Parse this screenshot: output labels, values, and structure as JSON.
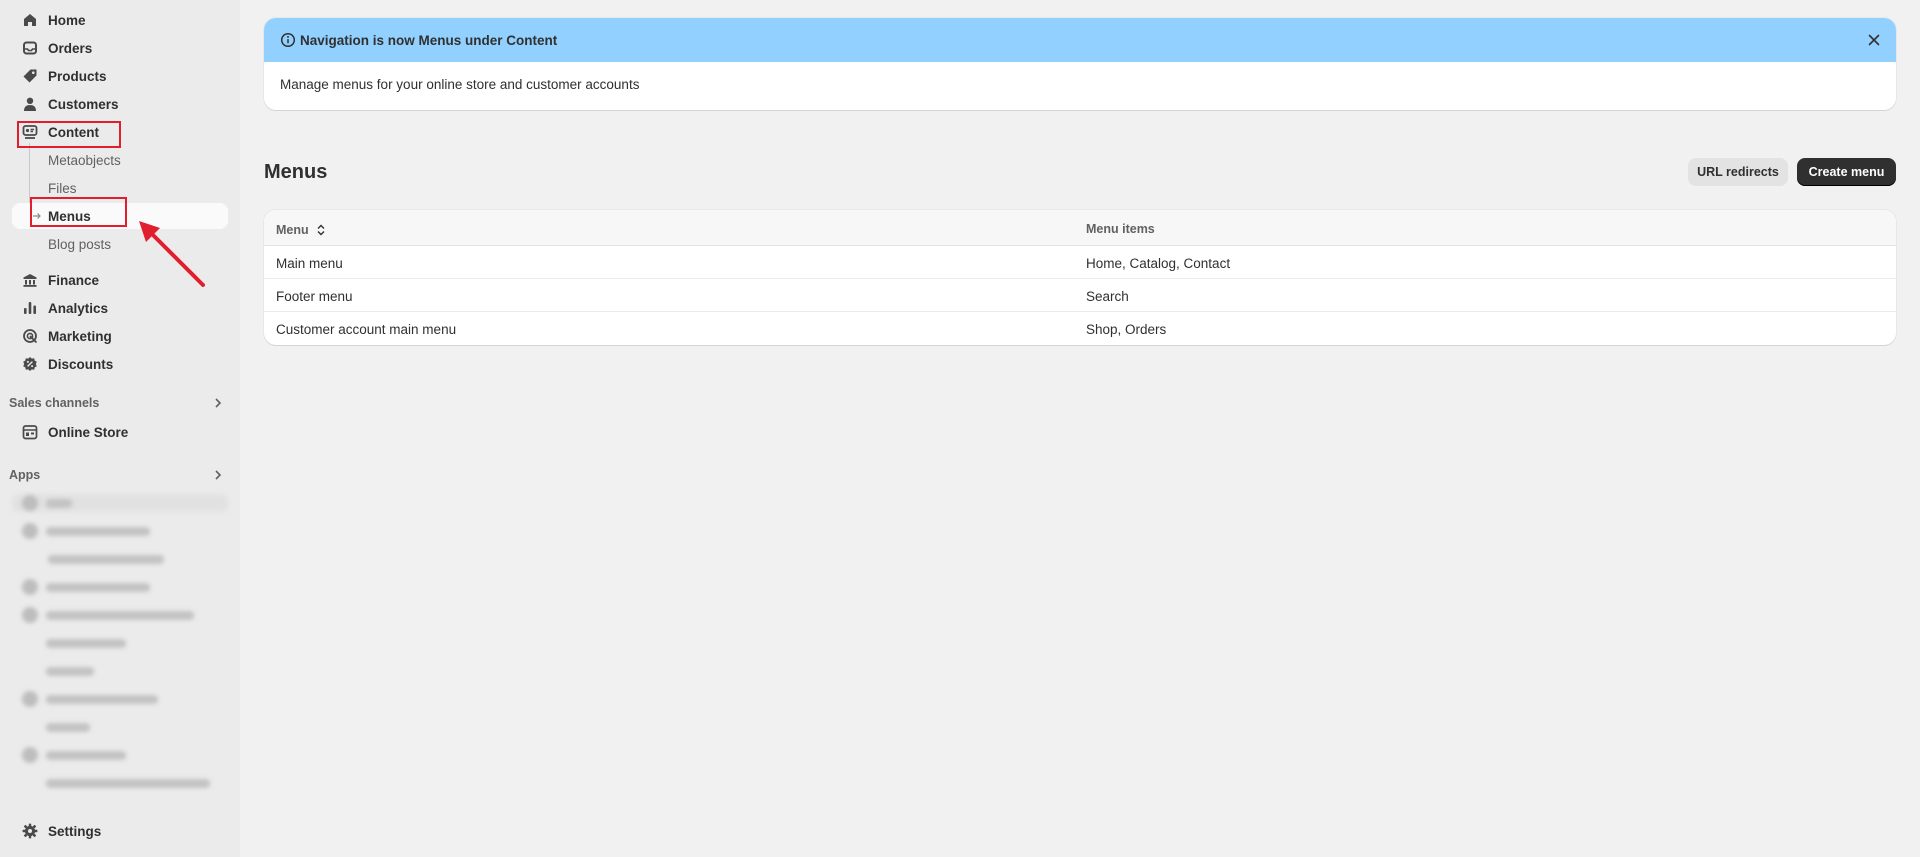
{
  "sidebar": {
    "items": [
      {
        "label": "Home",
        "icon": "home-icon"
      },
      {
        "label": "Orders",
        "icon": "inbox-icon"
      },
      {
        "label": "Products",
        "icon": "tag-icon"
      },
      {
        "label": "Customers",
        "icon": "person-icon"
      },
      {
        "label": "Content",
        "icon": "content-icon"
      },
      {
        "label": "Metaobjects"
      },
      {
        "label": "Files"
      },
      {
        "label": "Menus"
      },
      {
        "label": "Blog posts"
      },
      {
        "label": "Finance",
        "icon": "bank-icon"
      },
      {
        "label": "Analytics",
        "icon": "bar-chart-icon"
      },
      {
        "label": "Marketing",
        "icon": "target-icon"
      },
      {
        "label": "Discounts",
        "icon": "discount-icon"
      }
    ],
    "sales_channels": {
      "heading": "Sales channels",
      "items": [
        {
          "label": "Online Store",
          "icon": "store-icon"
        }
      ]
    },
    "apps": {
      "heading": "Apps"
    },
    "settings": {
      "label": "Settings",
      "icon": "gear-icon"
    }
  },
  "banner": {
    "title": "Navigation is now Menus under Content",
    "body": "Manage menus for your online store and customer accounts"
  },
  "page": {
    "title": "Menus",
    "secondary_action": "URL redirects",
    "primary_action": "Create menu"
  },
  "table": {
    "columns": [
      "Menu",
      "Menu items"
    ],
    "rows": [
      {
        "menu": "Main menu",
        "items": "Home, Catalog, Contact"
      },
      {
        "menu": "Footer menu",
        "items": "Search"
      },
      {
        "menu": "Customer account main menu",
        "items": "Shop, Orders"
      }
    ]
  },
  "colors": {
    "banner_info": "#91d0ff",
    "primary_button": "#303030",
    "annotation_red": "#e11d2e"
  }
}
